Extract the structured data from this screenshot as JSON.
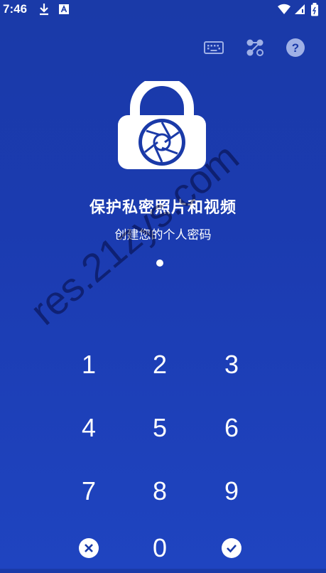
{
  "status_bar": {
    "time": "7:46",
    "left_icons": [
      "download-icon",
      "font-a-icon"
    ],
    "right_icons": [
      "wifi-icon",
      "signal-icon",
      "battery-icon"
    ]
  },
  "top_actions": [
    "keyboard-icon",
    "pattern-icon",
    "help-icon"
  ],
  "header": {
    "title": "保护私密照片和视频",
    "subtitle": "创建您的个人密码",
    "logo_icon": "lock-shutter-icon"
  },
  "pin": {
    "entered_count": 1
  },
  "keypad": {
    "keys": [
      "1",
      "2",
      "3",
      "4",
      "5",
      "6",
      "7",
      "8",
      "9",
      "0"
    ],
    "cancel_icon": "close-circle-icon",
    "confirm_icon": "check-circle-icon"
  },
  "watermark": "res.21zys.com",
  "colors": {
    "background_top": "#1a3aa8",
    "background_bottom": "#1f44c0",
    "foreground": "#ffffff",
    "icon_muted": "#9fb0e6"
  }
}
